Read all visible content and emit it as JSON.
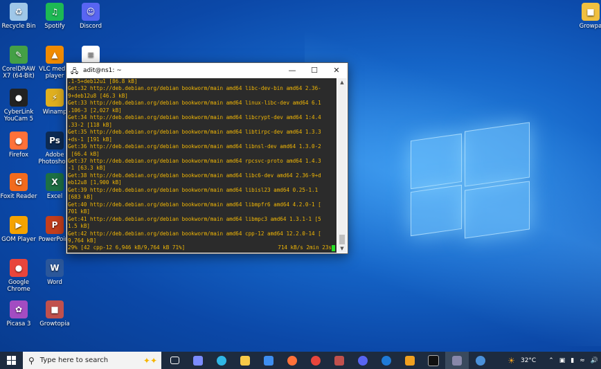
{
  "desktop": {
    "icons": [
      {
        "label": "Recycle Bin",
        "icon": "recycle-bin-icon",
        "color": "#9fc7e8"
      },
      {
        "label": "Spotify",
        "icon": "spotify-icon",
        "color": "#1db954"
      },
      {
        "label": "Discord",
        "icon": "discord-icon",
        "color": "#5865f2"
      },
      {
        "label": "CorelDRAW X7 (64-Bit)",
        "icon": "coreldraw-icon",
        "color": "#44a046"
      },
      {
        "label": "VLC media player",
        "icon": "vlc-icon",
        "color": "#f08a00"
      },
      {
        "label": "",
        "icon": "document-icon",
        "color": "#ffffff"
      },
      {
        "label": "CyberLink YouCam 5",
        "icon": "youcam-icon",
        "color": "#222222"
      },
      {
        "label": "Winamp",
        "icon": "winamp-icon",
        "color": "#e0b020"
      },
      {
        "label": "Firefox",
        "icon": "firefox-icon",
        "color": "#ff7139"
      },
      {
        "label": "Adobe Photosho...",
        "icon": "photoshop-icon",
        "color": "#0d2b54"
      },
      {
        "label": "Foxit Reader",
        "icon": "foxit-icon",
        "color": "#f26b1d"
      },
      {
        "label": "Excel",
        "icon": "excel-icon",
        "color": "#1d7044"
      },
      {
        "label": "GOM Player",
        "icon": "gom-player-icon",
        "color": "#f5a300"
      },
      {
        "label": "PowerPoint",
        "icon": "powerpoint-icon",
        "color": "#c43e1c"
      },
      {
        "label": "Google Chrome",
        "icon": "chrome-icon",
        "color": "#e8453c"
      },
      {
        "label": "Word",
        "icon": "word-icon",
        "color": "#2b579a"
      },
      {
        "label": "Picasa 3",
        "icon": "picasa-icon",
        "color": "#a34cc2"
      },
      {
        "label": "Growtopia",
        "icon": "growtopia-icon",
        "color": "#c0504d"
      },
      {
        "label": "Growpa",
        "icon": "growpa-icon",
        "color": "#f0c040"
      }
    ]
  },
  "terminal": {
    "title": "adit@ns1: ~",
    "lines": [
      ".1-5+deb12u1 [86.8 kB]",
      "Get:32 http://deb.debian.org/debian bookworm/main amd64 libc-dev-bin amd64 2.36-",
      "9+deb12u8 [46.3 kB]",
      "Get:33 http://deb.debian.org/debian bookworm/main amd64 linux-libc-dev amd64 6.1",
      ".106-3 [2,027 kB]",
      "Get:34 http://deb.debian.org/debian bookworm/main amd64 libcrypt-dev amd64 1:4.4",
      ".33-2 [118 kB]",
      "Get:35 http://deb.debian.org/debian bookworm/main amd64 libtirpc-dev amd64 1.3.3",
      "+ds-1 [191 kB]",
      "Get:36 http://deb.debian.org/debian bookworm/main amd64 libnsl-dev amd64 1.3.0-2",
      " [66.4 kB]",
      "Get:37 http://deb.debian.org/debian bookworm/main amd64 rpcsvc-proto amd64 1.4.3",
      "-1 [63.3 kB]",
      "Get:38 http://deb.debian.org/debian bookworm/main amd64 libc6-dev amd64 2.36-9+d",
      "eb12u8 [1,900 kB]",
      "Get:39 http://deb.debian.org/debian bookworm/main amd64 libisl23 amd64 0.25-1.1",
      "[683 kB]",
      "Get:40 http://deb.debian.org/debian bookworm/main amd64 libmpfr6 amd64 4.2.0-1 [",
      "701 kB]",
      "Get:41 http://deb.debian.org/debian bookworm/main amd64 libmpc3 amd64 1.3.1-1 [5",
      "1.5 kB]",
      "Get:42 http://deb.debian.org/debian bookworm/main amd64 cpp-12 amd64 12.2.0-14 [",
      "9,764 kB]"
    ],
    "status_left": "29% [42 cpp-12 6,946 kB/9,764 kB 71%]",
    "status_right": "714 kB/s 2min 23s"
  },
  "taskbar": {
    "search_placeholder": "Type here to search",
    "apps": [
      {
        "icon": "task-view-icon",
        "color": "#ffffff"
      },
      {
        "icon": "copilot-icon",
        "color": "#7b8cff"
      },
      {
        "icon": "edge-icon",
        "color": "#2fb6e6"
      },
      {
        "icon": "file-explorer-icon",
        "color": "#f7c948"
      },
      {
        "icon": "microsoft-store-icon",
        "color": "#3d8ef0"
      },
      {
        "icon": "firefox-icon",
        "color": "#ff7139"
      },
      {
        "icon": "chrome-icon",
        "color": "#e8453c"
      },
      {
        "icon": "growtopia-icon",
        "color": "#c0504d"
      },
      {
        "icon": "discord-icon",
        "color": "#5865f2"
      },
      {
        "icon": "edge-dev-icon",
        "color": "#1f7ad6"
      },
      {
        "icon": "virtualbox-icon",
        "color": "#f0a020"
      },
      {
        "icon": "terminal-icon",
        "color": "#111111"
      },
      {
        "icon": "putty-icon",
        "color": "#8888aa"
      },
      {
        "icon": "app-icon",
        "color": "#4a90d9"
      }
    ],
    "weather": "32°C",
    "tray_icons": [
      "chevron-up-icon",
      "network-icon",
      "battery-icon",
      "wifi-icon",
      "volume-icon"
    ]
  }
}
